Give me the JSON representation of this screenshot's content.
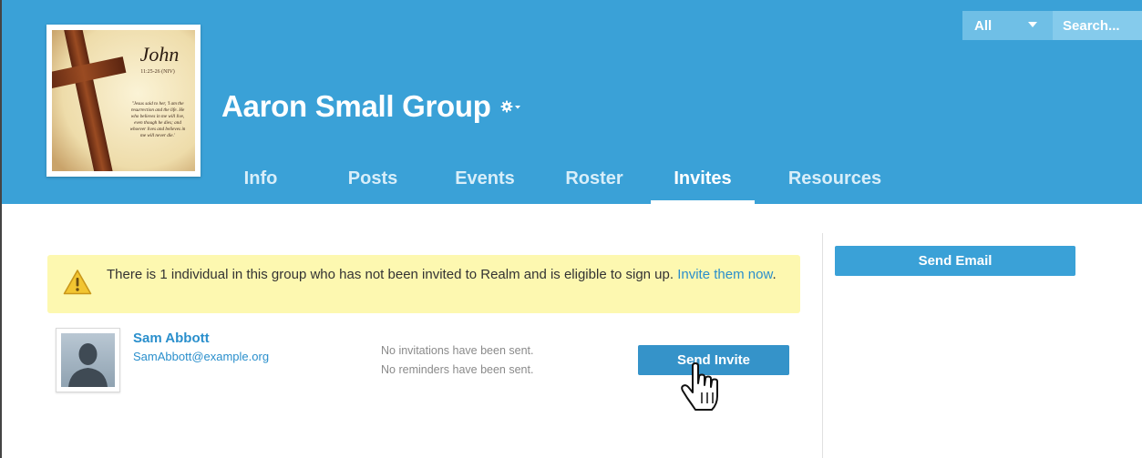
{
  "header": {
    "group_name": "Aaron Small Group",
    "image": {
      "title": "John",
      "reference": "11:25-26 (NIV)",
      "verse_lines": [
        "\"Jesus said to her, 'I am the",
        "resurrection and the life. He",
        "who believes in me will live,",
        "even though he dies; and",
        "whoever lives and believes in",
        "me will never die.'"
      ]
    },
    "tabs": [
      {
        "label": "Info",
        "active": false
      },
      {
        "label": "Posts",
        "active": false
      },
      {
        "label": "Events",
        "active": false
      },
      {
        "label": "Roster",
        "active": false
      },
      {
        "label": "Invites",
        "active": true
      },
      {
        "label": "Resources",
        "active": false
      }
    ]
  },
  "search": {
    "scope": "All",
    "placeholder": "Search..."
  },
  "alert": {
    "message": "There is 1 individual in this group who has not been invited to Realm and is eligible to sign up. ",
    "link_text": "Invite them now",
    "suffix": "."
  },
  "person": {
    "name": "Sam Abbott",
    "email": "SamAbbott@example.org",
    "status_invitations": "No invitations have been sent.",
    "status_reminders": "No reminders have been sent.",
    "action_label": "Send Invite"
  },
  "sidebar": {
    "send_email_label": "Send Email"
  },
  "colors": {
    "header_bg": "#3aa1d7",
    "link": "#2a8fcc",
    "alert_bg": "#fdf8b0",
    "button": "#3593c9"
  },
  "icons": {
    "gear": "gear-icon",
    "warning": "warning-icon",
    "avatar": "default-avatar-icon",
    "cursor": "hand-pointer-cursor"
  }
}
